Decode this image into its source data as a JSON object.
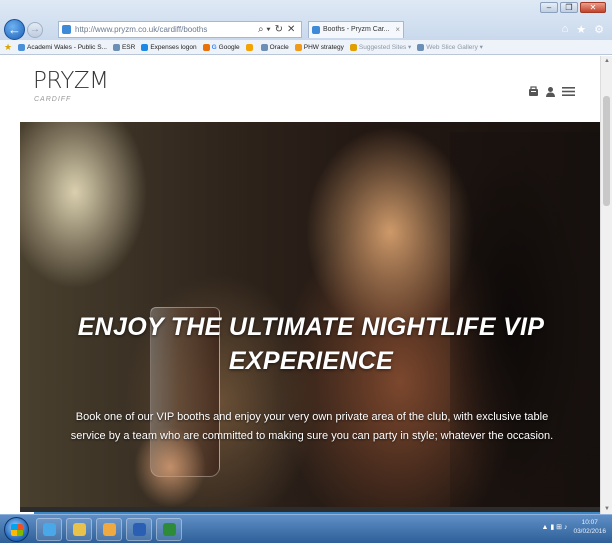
{
  "browser": {
    "address": "http://www.pryzm.co.uk/cardiff/booths",
    "tab_title": "Booths - Pryzm Car...",
    "tab_close": "×",
    "tools": [
      "⌕ ▾",
      "🔒",
      "↻",
      "✕"
    ],
    "window_controls": [
      "–",
      "❐",
      "✕"
    ],
    "right_icons": [
      "⌂",
      "★",
      "⚙"
    ]
  },
  "favorites": [
    {
      "label": "Academi Wales - Public S...",
      "color": "#4a90d9",
      "faded": false
    },
    {
      "label": "ESR",
      "color": "#6b8fb5",
      "faded": false
    },
    {
      "label": "Expenses logon",
      "color": "#1e88e5",
      "faded": false
    },
    {
      "label": "Google",
      "color": "#e8710a",
      "faded": false,
      "prefix": "G"
    },
    {
      "label": "",
      "color": "#f4a300",
      "faded": false
    },
    {
      "label": "Oracle",
      "color": "#6b8fb5",
      "faded": false
    },
    {
      "label": "PHW strategy",
      "color": "#f09a1a",
      "faded": false
    },
    {
      "label": "Suggested Sites ▾",
      "color": "#e0a000",
      "faded": true
    },
    {
      "label": "Web Slice Gallery ▾",
      "color": "#6b8fb5",
      "faded": true
    }
  ],
  "site": {
    "logo": "PRYZM",
    "logo_sub": "CARDIFF",
    "header_icons": [
      "🎟",
      "👤",
      "☰"
    ]
  },
  "hero": {
    "title_line1": "ENJOY THE ULTIMATE NIGHTLIFE VIP",
    "title_line2": "EXPERIENCE",
    "subtitle_line1": "Book one of our VIP booths and enjoy your very own private area of the club, with exclusive table",
    "subtitle_line2": "service by a team who are committed to making sure you can party in style; whatever the occasion."
  },
  "taskbar": {
    "items": [
      {
        "name": "ie",
        "color": "#4ba8e8"
      },
      {
        "name": "explorer",
        "color": "#e8c24a"
      },
      {
        "name": "paint",
        "color": "#f0a840"
      },
      {
        "name": "word",
        "color": "#2b5fb4"
      },
      {
        "name": "excel",
        "color": "#2e8b3a"
      }
    ],
    "tray_icons": "▲ ▮ ⊞ ♪",
    "time": "10:07",
    "date": "03/02/2016"
  }
}
